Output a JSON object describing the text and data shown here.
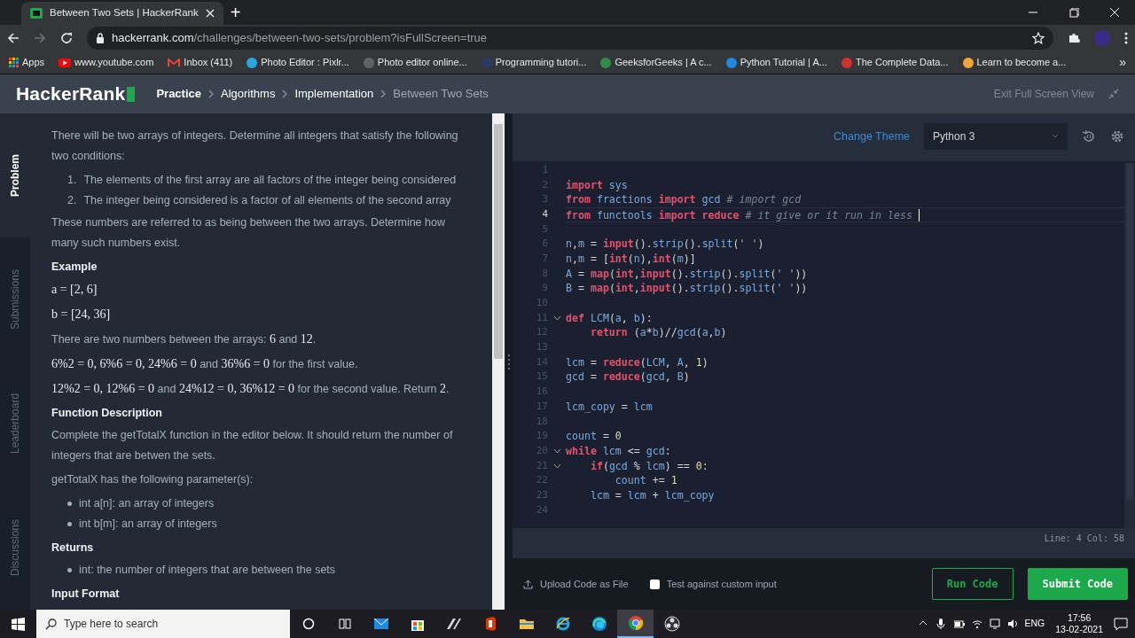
{
  "browser": {
    "tab_title": "Between Two Sets | HackerRank",
    "new_tab": "+",
    "url_host": "hackerrank.com",
    "url_path": "/challenges/between-two-sets/problem?isFullScreen=true",
    "bookmarks": [
      {
        "label": "Apps",
        "kind": "apps"
      },
      {
        "label": "www.youtube.com",
        "kind": "play",
        "color": "#ff0000"
      },
      {
        "label": "Inbox (411)",
        "kind": "mail",
        "color": "#ea4335"
      },
      {
        "label": "Photo Editor : Pixlr...",
        "kind": "circle",
        "color": "#2aa7e0"
      },
      {
        "label": "Photo editor online...",
        "kind": "circle",
        "color": "#5f6368"
      },
      {
        "label": "Programming tutori...",
        "kind": "circle",
        "color": "#2b3a67"
      },
      {
        "label": "GeeksforGeeks | A c...",
        "kind": "circle",
        "color": "#2f8d46"
      },
      {
        "label": "Python Tutorial | A...",
        "kind": "circle",
        "color": "#1e88e5"
      },
      {
        "label": "The Complete Data...",
        "kind": "circle",
        "color": "#d32f2f"
      },
      {
        "label": "Learn to become a...",
        "kind": "circle",
        "color": "#f2a33a"
      }
    ],
    "bookmarks_more": "»"
  },
  "header": {
    "logo": "HackerRank",
    "breadcrumbs": [
      {
        "label": "Practice",
        "current": false
      },
      {
        "label": "Algorithms",
        "current": false
      },
      {
        "label": "Implementation",
        "current": false
      },
      {
        "label": "Between Two Sets",
        "current": true
      }
    ],
    "exit_full_screen": "Exit Full Screen View"
  },
  "side_tabs": [
    {
      "label": "Problem",
      "selected": true
    },
    {
      "label": "Submissions",
      "selected": false
    },
    {
      "label": "Leaderboard",
      "selected": false
    },
    {
      "label": "Discussions",
      "selected": false
    }
  ],
  "problem": [
    {
      "kind": "paragraph",
      "parts": [
        {
          "kind": "text",
          "text": "There will be two arrays of integers. Determine all integers that satisfy the following two conditions:"
        }
      ]
    },
    {
      "kind": "ordered",
      "items": [
        "The elements of the first array are all factors of the integer being considered",
        "The integer being considered is a factor of all elements of the second array"
      ],
      "markers": [
        "1.",
        "2."
      ]
    },
    {
      "kind": "paragraph",
      "parts": [
        {
          "kind": "text",
          "text": "These numbers are referred to as being between the two arrays. Determine how many such numbers exist."
        }
      ]
    },
    {
      "kind": "heading",
      "text": "Example"
    },
    {
      "kind": "paragraph",
      "parts": [
        {
          "kind": "math",
          "text": "a = [2, 6]"
        }
      ]
    },
    {
      "kind": "paragraph",
      "parts": [
        {
          "kind": "math",
          "text": "b = [24, 36]"
        }
      ]
    },
    {
      "kind": "paragraph",
      "parts": [
        {
          "kind": "text",
          "text": "There are two numbers between the arrays: "
        },
        {
          "kind": "math",
          "text": "6"
        },
        {
          "kind": "text",
          "text": " and "
        },
        {
          "kind": "math",
          "text": "12"
        },
        {
          "kind": "text",
          "text": "."
        }
      ]
    },
    {
      "kind": "paragraph",
      "parts": [
        {
          "kind": "math",
          "text": "6%2 = 0, 6%6 = 0, 24%6 = 0"
        },
        {
          "kind": "text",
          "text": " and "
        },
        {
          "kind": "math",
          "text": "36%6 = 0"
        },
        {
          "kind": "text",
          "text": " for the first value."
        }
      ]
    },
    {
      "kind": "paragraph",
      "parts": [
        {
          "kind": "math",
          "text": "12%2 = 0, 12%6 = 0"
        },
        {
          "kind": "text",
          "text": " and "
        },
        {
          "kind": "math",
          "text": "24%12 = 0, 36%12 = 0"
        },
        {
          "kind": "text",
          "text": " for the second value. Return "
        },
        {
          "kind": "math",
          "text": "2"
        },
        {
          "kind": "text",
          "text": "."
        }
      ]
    },
    {
      "kind": "heading",
      "text": "Function Description"
    },
    {
      "kind": "paragraph",
      "parts": [
        {
          "kind": "text",
          "text": "Complete the getTotalX function in the editor below. It should return the number of integers that are betwen the sets."
        }
      ]
    },
    {
      "kind": "paragraph",
      "parts": [
        {
          "kind": "text",
          "text": "getTotalX has the following parameter(s):"
        }
      ]
    },
    {
      "kind": "bullets",
      "items": [
        "int a[n]: an array of integers",
        "int b[m]: an array of integers"
      ]
    },
    {
      "kind": "heading",
      "text": "Returns"
    },
    {
      "kind": "bullets",
      "items": [
        "int: the number of integers that are between the sets"
      ]
    },
    {
      "kind": "heading",
      "text": "Input Format"
    }
  ],
  "editor": {
    "change_theme": "Change Theme",
    "language": "Python 3",
    "status": "Line: 4 Col: 58",
    "lines": [
      {
        "number": "1",
        "fold": false,
        "current": false
      },
      {
        "number": "2",
        "fold": false,
        "current": false,
        "tokens": [
          {
            "kind": "kw",
            "text": "import"
          },
          {
            "kind": "name",
            "text": " sys"
          }
        ]
      },
      {
        "number": "3",
        "fold": false,
        "current": false,
        "tokens": [
          {
            "kind": "kw",
            "text": "from"
          },
          {
            "kind": "name",
            "text": " fractions "
          },
          {
            "kind": "kw",
            "text": "import"
          },
          {
            "kind": "name",
            "text": " gcd "
          },
          {
            "kind": "comment",
            "text": "# import gcd"
          }
        ]
      },
      {
        "number": "4",
        "fold": false,
        "current": true,
        "tokens": [
          {
            "kind": "kw",
            "text": "from"
          },
          {
            "kind": "name",
            "text": " functools "
          },
          {
            "kind": "kw",
            "text": "import"
          },
          {
            "kind": "kw",
            "text": " reduce"
          },
          {
            "kind": "comment",
            "text": " # it give or it run in less "
          }
        ]
      },
      {
        "number": "5",
        "fold": false,
        "current": false
      },
      {
        "number": "6",
        "fold": false,
        "current": false,
        "tokens": [
          {
            "kind": "name",
            "text": "n"
          },
          {
            "kind": "punct",
            "text": ","
          },
          {
            "kind": "name",
            "text": "m"
          },
          {
            "kind": "punct",
            "text": " = "
          },
          {
            "kind": "kw",
            "text": "input"
          },
          {
            "kind": "punct",
            "text": "()."
          },
          {
            "kind": "name",
            "text": "strip"
          },
          {
            "kind": "punct",
            "text": "()."
          },
          {
            "kind": "name",
            "text": "split"
          },
          {
            "kind": "punct",
            "text": "("
          },
          {
            "kind": "string",
            "text": "' '"
          },
          {
            "kind": "punct",
            "text": ")"
          }
        ]
      },
      {
        "number": "7",
        "fold": false,
        "current": false,
        "tokens": [
          {
            "kind": "name",
            "text": "n"
          },
          {
            "kind": "punct",
            "text": ","
          },
          {
            "kind": "name",
            "text": "m"
          },
          {
            "kind": "punct",
            "text": " = ["
          },
          {
            "kind": "kw",
            "text": "int"
          },
          {
            "kind": "punct",
            "text": "("
          },
          {
            "kind": "name",
            "text": "n"
          },
          {
            "kind": "punct",
            "text": "),"
          },
          {
            "kind": "kw",
            "text": "int"
          },
          {
            "kind": "punct",
            "text": "("
          },
          {
            "kind": "name",
            "text": "m"
          },
          {
            "kind": "punct",
            "text": ")]"
          }
        ]
      },
      {
        "number": "8",
        "fold": false,
        "current": false,
        "tokens": [
          {
            "kind": "name",
            "text": "A"
          },
          {
            "kind": "punct",
            "text": " = "
          },
          {
            "kind": "kw",
            "text": "map"
          },
          {
            "kind": "punct",
            "text": "("
          },
          {
            "kind": "kw",
            "text": "int"
          },
          {
            "kind": "punct",
            "text": ","
          },
          {
            "kind": "kw",
            "text": "input"
          },
          {
            "kind": "punct",
            "text": "()."
          },
          {
            "kind": "name",
            "text": "strip"
          },
          {
            "kind": "punct",
            "text": "()."
          },
          {
            "kind": "name",
            "text": "split"
          },
          {
            "kind": "punct",
            "text": "("
          },
          {
            "kind": "string",
            "text": "' '"
          },
          {
            "kind": "punct",
            "text": "))"
          }
        ]
      },
      {
        "number": "9",
        "fold": false,
        "current": false,
        "tokens": [
          {
            "kind": "name",
            "text": "B"
          },
          {
            "kind": "punct",
            "text": " = "
          },
          {
            "kind": "kw",
            "text": "map"
          },
          {
            "kind": "punct",
            "text": "("
          },
          {
            "kind": "kw",
            "text": "int"
          },
          {
            "kind": "punct",
            "text": ","
          },
          {
            "kind": "kw",
            "text": "input"
          },
          {
            "kind": "punct",
            "text": "()."
          },
          {
            "kind": "name",
            "text": "strip"
          },
          {
            "kind": "punct",
            "text": "()."
          },
          {
            "kind": "name",
            "text": "split"
          },
          {
            "kind": "punct",
            "text": "("
          },
          {
            "kind": "string",
            "text": "' '"
          },
          {
            "kind": "punct",
            "text": "))"
          }
        ]
      },
      {
        "number": "10",
        "fold": false,
        "current": false
      },
      {
        "number": "11",
        "fold": true,
        "current": false,
        "tokens": [
          {
            "kind": "kw",
            "text": "def"
          },
          {
            "kind": "name",
            "text": " LCM"
          },
          {
            "kind": "punct",
            "text": "("
          },
          {
            "kind": "name",
            "text": "a"
          },
          {
            "kind": "punct",
            "text": ", "
          },
          {
            "kind": "name",
            "text": "b"
          },
          {
            "kind": "punct",
            "text": "):"
          }
        ]
      },
      {
        "number": "12",
        "fold": false,
        "current": false,
        "tokens": [
          {
            "kind": "kw",
            "text": "    return"
          },
          {
            "kind": "punct",
            "text": " ("
          },
          {
            "kind": "name",
            "text": "a"
          },
          {
            "kind": "punct",
            "text": "*"
          },
          {
            "kind": "name",
            "text": "b"
          },
          {
            "kind": "punct",
            "text": ")//"
          },
          {
            "kind": "name",
            "text": "gcd"
          },
          {
            "kind": "punct",
            "text": "("
          },
          {
            "kind": "name",
            "text": "a"
          },
          {
            "kind": "punct",
            "text": ","
          },
          {
            "kind": "name",
            "text": "b"
          },
          {
            "kind": "punct",
            "text": ")"
          }
        ]
      },
      {
        "number": "13",
        "fold": false,
        "current": false
      },
      {
        "number": "14",
        "fold": false,
        "current": false,
        "tokens": [
          {
            "kind": "name",
            "text": "lcm"
          },
          {
            "kind": "punct",
            "text": " = "
          },
          {
            "kind": "kw",
            "text": "reduce"
          },
          {
            "kind": "punct",
            "text": "("
          },
          {
            "kind": "name",
            "text": "LCM"
          },
          {
            "kind": "punct",
            "text": ", "
          },
          {
            "kind": "name",
            "text": "A"
          },
          {
            "kind": "punct",
            "text": ", "
          },
          {
            "kind": "number",
            "text": "1"
          },
          {
            "kind": "punct",
            "text": ")"
          }
        ]
      },
      {
        "number": "15",
        "fold": false,
        "current": false,
        "tokens": [
          {
            "kind": "name",
            "text": "gcd"
          },
          {
            "kind": "punct",
            "text": " = "
          },
          {
            "kind": "kw",
            "text": "reduce"
          },
          {
            "kind": "punct",
            "text": "("
          },
          {
            "kind": "name",
            "text": "gcd"
          },
          {
            "kind": "punct",
            "text": ", "
          },
          {
            "kind": "name",
            "text": "B"
          },
          {
            "kind": "punct",
            "text": ")"
          }
        ]
      },
      {
        "number": "16",
        "fold": false,
        "current": false
      },
      {
        "number": "17",
        "fold": false,
        "current": false,
        "tokens": [
          {
            "kind": "name",
            "text": "lcm_copy"
          },
          {
            "kind": "punct",
            "text": " = "
          },
          {
            "kind": "name",
            "text": "lcm"
          }
        ]
      },
      {
        "number": "18",
        "fold": false,
        "current": false
      },
      {
        "number": "19",
        "fold": false,
        "current": false,
        "tokens": [
          {
            "kind": "name",
            "text": "count"
          },
          {
            "kind": "punct",
            "text": " = "
          },
          {
            "kind": "number",
            "text": "0"
          }
        ]
      },
      {
        "number": "20",
        "fold": true,
        "current": false,
        "tokens": [
          {
            "kind": "kw",
            "text": "while"
          },
          {
            "kind": "name",
            "text": " lcm"
          },
          {
            "kind": "punct",
            "text": " <= "
          },
          {
            "kind": "name",
            "text": "gcd"
          },
          {
            "kind": "punct",
            "text": ":"
          }
        ]
      },
      {
        "number": "21",
        "fold": true,
        "current": false,
        "tokens": [
          {
            "kind": "kw",
            "text": "    if"
          },
          {
            "kind": "punct",
            "text": "("
          },
          {
            "kind": "name",
            "text": "gcd"
          },
          {
            "kind": "punct",
            "text": " % "
          },
          {
            "kind": "name",
            "text": "lcm"
          },
          {
            "kind": "punct",
            "text": ") == "
          },
          {
            "kind": "number",
            "text": "0"
          },
          {
            "kind": "punct",
            "text": ":"
          }
        ]
      },
      {
        "number": "22",
        "fold": false,
        "current": false,
        "tokens": [
          {
            "kind": "name",
            "text": "        count"
          },
          {
            "kind": "punct",
            "text": " += "
          },
          {
            "kind": "number",
            "text": "1"
          }
        ]
      },
      {
        "number": "23",
        "fold": false,
        "current": false,
        "tokens": [
          {
            "kind": "name",
            "text": "    lcm"
          },
          {
            "kind": "punct",
            "text": " = "
          },
          {
            "kind": "name",
            "text": "lcm"
          },
          {
            "kind": "punct",
            "text": " + "
          },
          {
            "kind": "name",
            "text": "lcm_copy"
          }
        ]
      },
      {
        "number": "24",
        "fold": false,
        "current": false
      }
    ]
  },
  "footer": {
    "upload": "Upload Code as File",
    "custom_input": {
      "label": "Test against custom input",
      "checked": false
    },
    "run": "Run Code",
    "submit": "Submit Code"
  },
  "taskbar": {
    "search_placeholder": "Type here to search",
    "apps": [
      {
        "kind": "mail",
        "active": false
      },
      {
        "kind": "store",
        "active": false
      },
      {
        "kind": "pen",
        "active": false
      },
      {
        "kind": "office",
        "active": false
      },
      {
        "kind": "folder",
        "active": false
      },
      {
        "kind": "ie",
        "active": false
      },
      {
        "kind": "edge",
        "active": false
      },
      {
        "kind": "chrome",
        "active": true
      },
      {
        "kind": "obs",
        "active": false
      }
    ],
    "language": "ENG",
    "time": "17:56",
    "date": "13-02-2021"
  }
}
